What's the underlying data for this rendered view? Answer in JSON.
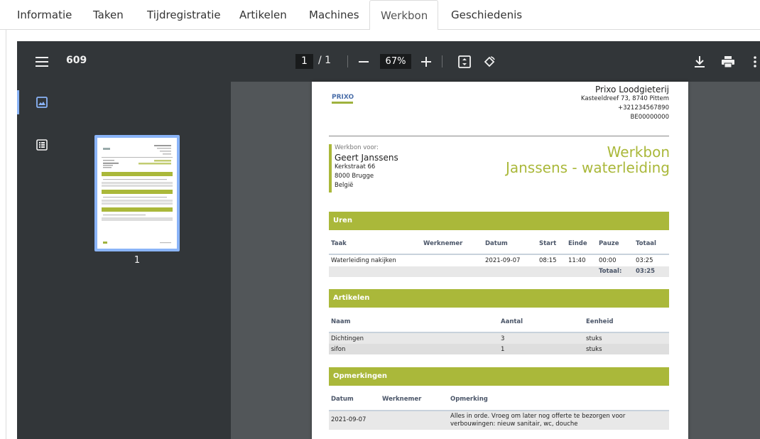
{
  "tabs": [
    {
      "label": "Informatie"
    },
    {
      "label": "Taken"
    },
    {
      "label": "Tijdregistratie"
    },
    {
      "label": "Artikelen"
    },
    {
      "label": "Machines"
    },
    {
      "label": "Werkbon"
    },
    {
      "label": "Geschiedenis"
    }
  ],
  "active_tab": "Werkbon",
  "viewer": {
    "title": "609",
    "page_current": "1",
    "page_total": "/ 1",
    "zoom": "67%",
    "thumbnail_label": "1",
    "icons": [
      "menu-icon",
      "zoom-out-icon",
      "zoom-in-icon",
      "fit-page-icon",
      "rotate-icon",
      "download-icon",
      "print-icon",
      "more-icon",
      "thumbnails-icon",
      "outline-icon"
    ]
  },
  "document": {
    "logo_text": "PRIXO",
    "company": {
      "name": "Prixo Loodgieterij",
      "address": "Kasteeldreef 73, 8740 Pittem",
      "phone": "+321234567890",
      "vat": "BE00000000"
    },
    "customer": {
      "label": "Werkbon voor:",
      "name": "Geert Janssens",
      "street": "Kerkstraat 66",
      "city": "8000 Brugge",
      "country": "België"
    },
    "title_line1": "Werkbon",
    "title_line2": "Janssens - waterleiding",
    "hours": {
      "section": "Uren",
      "headers": {
        "taak": "Taak",
        "werknemer": "Werknemer",
        "datum": "Datum",
        "start": "Start",
        "einde": "Einde",
        "pauze": "Pauze",
        "totaal": "Totaal"
      },
      "rows": [
        {
          "taak": "Waterleiding nakijken",
          "werknemer": "",
          "datum": "2021-09-07",
          "start": "08:15",
          "einde": "11:40",
          "pauze": "00:00",
          "totaal": "03:25"
        }
      ],
      "total_label": "Totaal:",
      "total_value": "03:25"
    },
    "articles": {
      "section": "Artikelen",
      "headers": {
        "naam": "Naam",
        "aantal": "Aantal",
        "eenheid": "Eenheid"
      },
      "rows": [
        {
          "naam": "Dichtingen",
          "aantal": "3",
          "eenheid": "stuks"
        },
        {
          "naam": "sifon",
          "aantal": "1",
          "eenheid": "stuks"
        }
      ]
    },
    "remarks": {
      "section": "Opmerkingen",
      "headers": {
        "datum": "Datum",
        "werknemer": "Werknemer",
        "opmerking": "Opmerking"
      },
      "rows": [
        {
          "datum": "2021-09-07",
          "werknemer": "",
          "opmerking_line1": "Alles in orde. Vroeg om later nog offerte te bezorgen voor",
          "opmerking_line2": "verbouwingen: nieuw sanitair, wc, douche"
        }
      ]
    }
  },
  "colors": {
    "accent": "#aab83a",
    "toolbar": "#323639",
    "viewer_bg": "#525659",
    "thumb_highlight": "#8ab4f8"
  }
}
